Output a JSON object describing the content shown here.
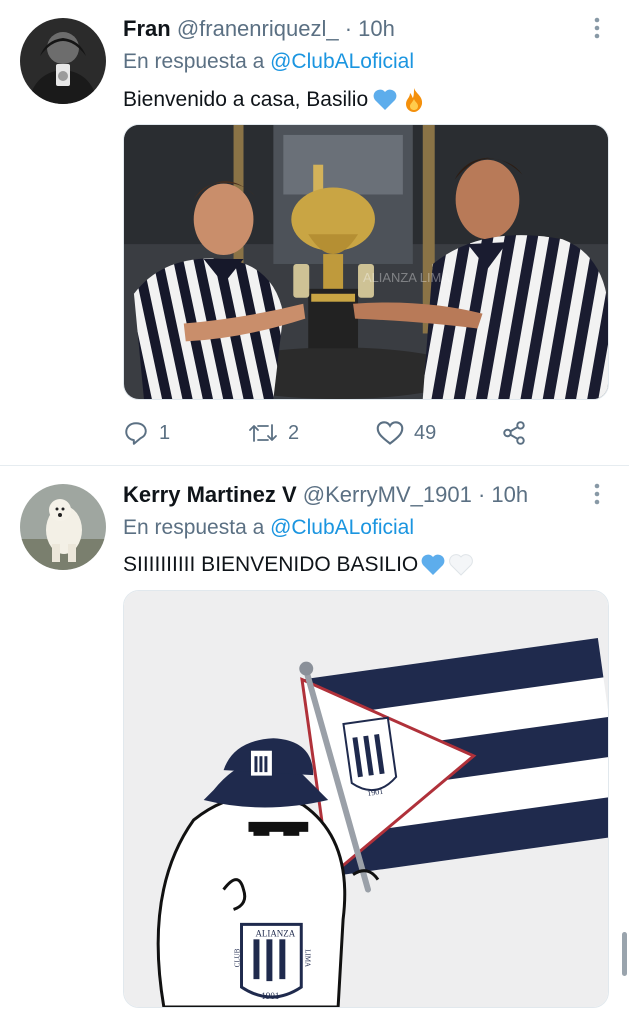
{
  "tweets": [
    {
      "name": "Fran",
      "handle": "@franenriquezl_",
      "separator": "·",
      "time": "10h",
      "reply_prefix": "En respuesta a",
      "reply_mention": "@ClubALoficial",
      "text": "Bienvenido a casa, Basilio",
      "emojis": [
        "blue-heart-icon",
        "fire-icon"
      ],
      "image_watermark": "ALIANZA LIMA",
      "stats": {
        "replies": "1",
        "retweets": "2",
        "likes": "49"
      }
    },
    {
      "name": "Kerry Martinez V",
      "handle": "@KerryMV_1901",
      "separator": "·",
      "time": "10h",
      "reply_prefix": "En respuesta a",
      "reply_mention": "@ClubALoficial",
      "text": "SIIIIIIIIII BIENVENIDO BASILIO",
      "emojis": [
        "blue-heart-icon",
        "white-heart-icon"
      ],
      "image_labels": {
        "crest_top": "ALIANZA",
        "crest_left": "CLUB",
        "crest_right": "LIMA",
        "crest_year": "1901"
      }
    }
  ],
  "colors": {
    "accent": "#1b95e0",
    "secondary_text": "#5b7083",
    "navy": "#1f2a4d",
    "heart_blue": "#5dadec"
  }
}
